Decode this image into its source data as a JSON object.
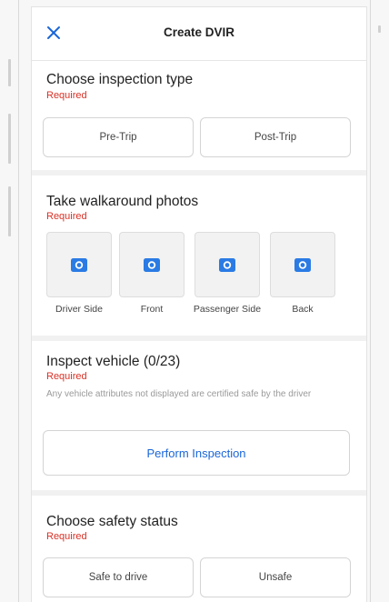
{
  "header": {
    "title": "Create DVIR",
    "close_icon": "close-icon"
  },
  "inspection_type": {
    "title": "Choose inspection type",
    "required": "Required",
    "options": [
      "Pre-Trip",
      "Post-Trip"
    ]
  },
  "walkaround": {
    "title": "Take walkaround photos",
    "required": "Required",
    "photos": [
      {
        "label": "Driver Side",
        "icon": "camera-icon"
      },
      {
        "label": "Front",
        "icon": "camera-icon"
      },
      {
        "label": "Passenger Side",
        "icon": "camera-icon"
      },
      {
        "label": "Back",
        "icon": "camera-icon"
      }
    ]
  },
  "inspect_vehicle": {
    "title": "Inspect vehicle (0/23)",
    "required": "Required",
    "note": "Any vehicle attributes not displayed are certified safe by the driver",
    "button_label": "Perform Inspection"
  },
  "safety_status": {
    "title": "Choose safety status",
    "required": "Required",
    "options": [
      "Safe to drive",
      "Unsafe"
    ]
  },
  "colors": {
    "accent": "#1a66d9",
    "required": "#d93025",
    "camera": "#2a7be4"
  }
}
